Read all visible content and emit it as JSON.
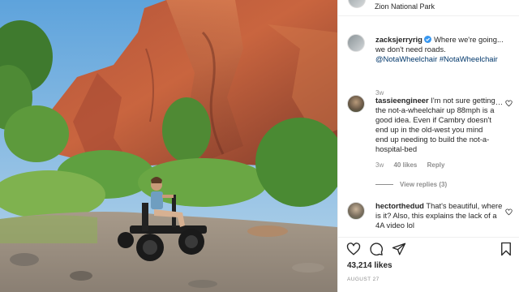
{
  "post": {
    "location": "Zion National Park",
    "likes": "43,214 likes",
    "date": "AUGUST 27"
  },
  "caption": {
    "user": "zacksjerryrig",
    "verified": true,
    "text": "Where we're going... we don't need roads.",
    "hashtags": "@NotaWheelchair #NotaWheelchair",
    "age": "3w"
  },
  "comments": [
    {
      "user": "tassieengineer",
      "text": "I'm not sure getting the not-a-wheelchair up 88mph is a good idea. Even if Cambry doesn't end up in the old-west you mind end up needing to build the not-a-hospital-bed",
      "age": "3w",
      "likes": "40 likes",
      "reply": "Reply",
      "view_replies": "View replies (3)",
      "more": "···"
    },
    {
      "user": "hectorthedud",
      "text": "That's beautiful, where is it? Also, this explains the lack of a 4A video lol"
    }
  ],
  "icons": {
    "verified": "verified-badge-icon",
    "heart": "heart-icon",
    "comment": "comment-icon",
    "share": "share-icon",
    "save": "bookmark-icon"
  },
  "colors": {
    "link": "#00376b",
    "verified": "#3897f0",
    "muted": "#8e8e8e",
    "text": "#262626"
  }
}
